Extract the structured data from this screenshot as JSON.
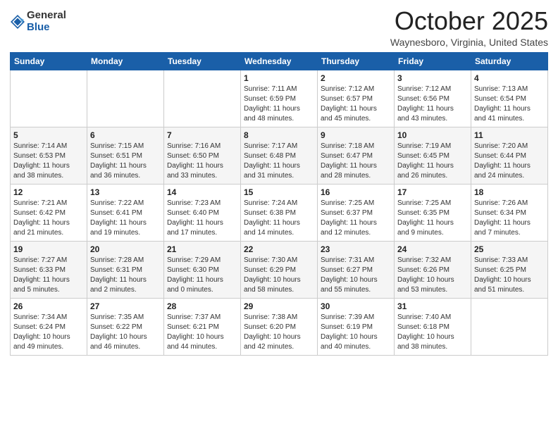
{
  "logo": {
    "general": "General",
    "blue": "Blue"
  },
  "header": {
    "month": "October 2025",
    "location": "Waynesboro, Virginia, United States"
  },
  "weekdays": [
    "Sunday",
    "Monday",
    "Tuesday",
    "Wednesday",
    "Thursday",
    "Friday",
    "Saturday"
  ],
  "weeks": [
    [
      {
        "day": "",
        "info": ""
      },
      {
        "day": "",
        "info": ""
      },
      {
        "day": "",
        "info": ""
      },
      {
        "day": "1",
        "info": "Sunrise: 7:11 AM\nSunset: 6:59 PM\nDaylight: 11 hours\nand 48 minutes."
      },
      {
        "day": "2",
        "info": "Sunrise: 7:12 AM\nSunset: 6:57 PM\nDaylight: 11 hours\nand 45 minutes."
      },
      {
        "day": "3",
        "info": "Sunrise: 7:12 AM\nSunset: 6:56 PM\nDaylight: 11 hours\nand 43 minutes."
      },
      {
        "day": "4",
        "info": "Sunrise: 7:13 AM\nSunset: 6:54 PM\nDaylight: 11 hours\nand 41 minutes."
      }
    ],
    [
      {
        "day": "5",
        "info": "Sunrise: 7:14 AM\nSunset: 6:53 PM\nDaylight: 11 hours\nand 38 minutes."
      },
      {
        "day": "6",
        "info": "Sunrise: 7:15 AM\nSunset: 6:51 PM\nDaylight: 11 hours\nand 36 minutes."
      },
      {
        "day": "7",
        "info": "Sunrise: 7:16 AM\nSunset: 6:50 PM\nDaylight: 11 hours\nand 33 minutes."
      },
      {
        "day": "8",
        "info": "Sunrise: 7:17 AM\nSunset: 6:48 PM\nDaylight: 11 hours\nand 31 minutes."
      },
      {
        "day": "9",
        "info": "Sunrise: 7:18 AM\nSunset: 6:47 PM\nDaylight: 11 hours\nand 28 minutes."
      },
      {
        "day": "10",
        "info": "Sunrise: 7:19 AM\nSunset: 6:45 PM\nDaylight: 11 hours\nand 26 minutes."
      },
      {
        "day": "11",
        "info": "Sunrise: 7:20 AM\nSunset: 6:44 PM\nDaylight: 11 hours\nand 24 minutes."
      }
    ],
    [
      {
        "day": "12",
        "info": "Sunrise: 7:21 AM\nSunset: 6:42 PM\nDaylight: 11 hours\nand 21 minutes."
      },
      {
        "day": "13",
        "info": "Sunrise: 7:22 AM\nSunset: 6:41 PM\nDaylight: 11 hours\nand 19 minutes."
      },
      {
        "day": "14",
        "info": "Sunrise: 7:23 AM\nSunset: 6:40 PM\nDaylight: 11 hours\nand 17 minutes."
      },
      {
        "day": "15",
        "info": "Sunrise: 7:24 AM\nSunset: 6:38 PM\nDaylight: 11 hours\nand 14 minutes."
      },
      {
        "day": "16",
        "info": "Sunrise: 7:25 AM\nSunset: 6:37 PM\nDaylight: 11 hours\nand 12 minutes."
      },
      {
        "day": "17",
        "info": "Sunrise: 7:25 AM\nSunset: 6:35 PM\nDaylight: 11 hours\nand 9 minutes."
      },
      {
        "day": "18",
        "info": "Sunrise: 7:26 AM\nSunset: 6:34 PM\nDaylight: 11 hours\nand 7 minutes."
      }
    ],
    [
      {
        "day": "19",
        "info": "Sunrise: 7:27 AM\nSunset: 6:33 PM\nDaylight: 11 hours\nand 5 minutes."
      },
      {
        "day": "20",
        "info": "Sunrise: 7:28 AM\nSunset: 6:31 PM\nDaylight: 11 hours\nand 2 minutes."
      },
      {
        "day": "21",
        "info": "Sunrise: 7:29 AM\nSunset: 6:30 PM\nDaylight: 11 hours\nand 0 minutes."
      },
      {
        "day": "22",
        "info": "Sunrise: 7:30 AM\nSunset: 6:29 PM\nDaylight: 10 hours\nand 58 minutes."
      },
      {
        "day": "23",
        "info": "Sunrise: 7:31 AM\nSunset: 6:27 PM\nDaylight: 10 hours\nand 55 minutes."
      },
      {
        "day": "24",
        "info": "Sunrise: 7:32 AM\nSunset: 6:26 PM\nDaylight: 10 hours\nand 53 minutes."
      },
      {
        "day": "25",
        "info": "Sunrise: 7:33 AM\nSunset: 6:25 PM\nDaylight: 10 hours\nand 51 minutes."
      }
    ],
    [
      {
        "day": "26",
        "info": "Sunrise: 7:34 AM\nSunset: 6:24 PM\nDaylight: 10 hours\nand 49 minutes."
      },
      {
        "day": "27",
        "info": "Sunrise: 7:35 AM\nSunset: 6:22 PM\nDaylight: 10 hours\nand 46 minutes."
      },
      {
        "day": "28",
        "info": "Sunrise: 7:37 AM\nSunset: 6:21 PM\nDaylight: 10 hours\nand 44 minutes."
      },
      {
        "day": "29",
        "info": "Sunrise: 7:38 AM\nSunset: 6:20 PM\nDaylight: 10 hours\nand 42 minutes."
      },
      {
        "day": "30",
        "info": "Sunrise: 7:39 AM\nSunset: 6:19 PM\nDaylight: 10 hours\nand 40 minutes."
      },
      {
        "day": "31",
        "info": "Sunrise: 7:40 AM\nSunset: 6:18 PM\nDaylight: 10 hours\nand 38 minutes."
      },
      {
        "day": "",
        "info": ""
      }
    ]
  ]
}
